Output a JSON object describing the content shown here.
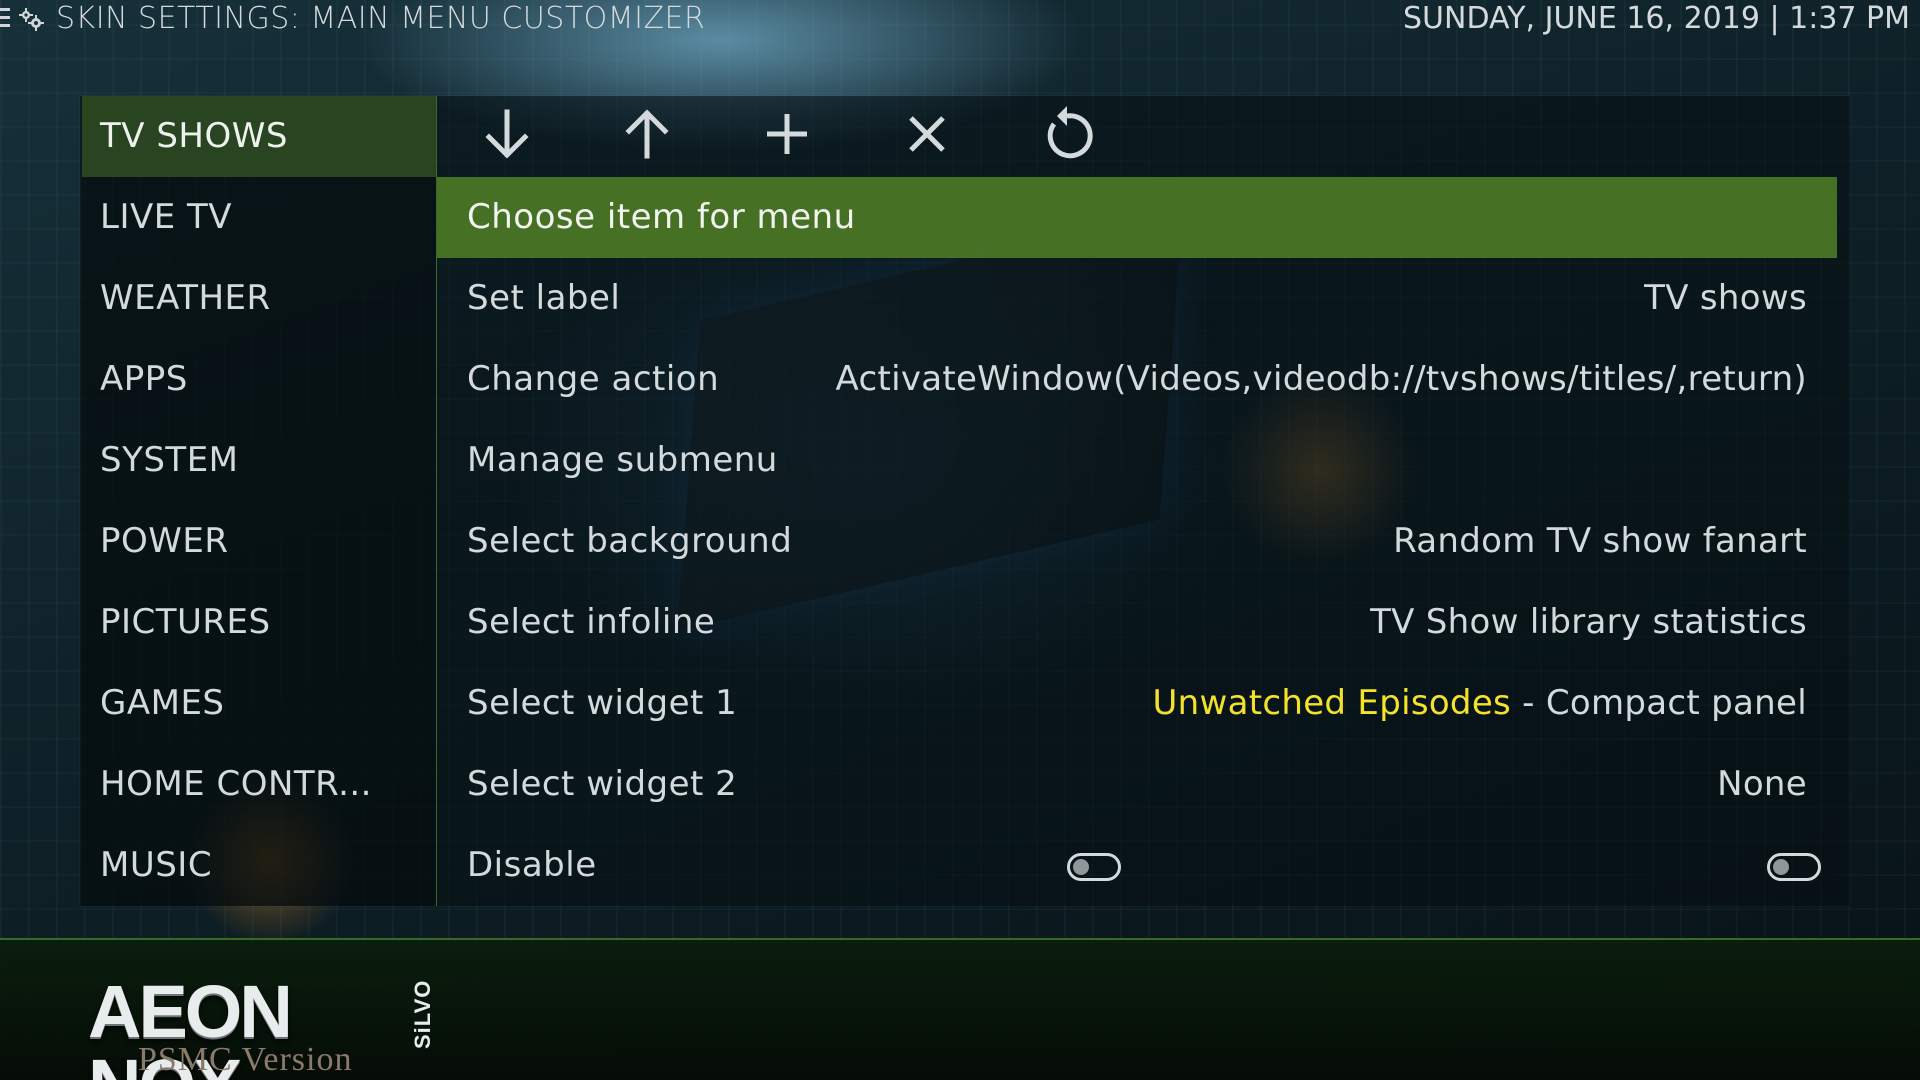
{
  "header": {
    "title": "SKIN SETTINGS: MAIN MENU CUSTOMIZER",
    "datetime": "SUNDAY, JUNE 16, 2019 | 1:37 PM"
  },
  "sidebar": {
    "items": [
      {
        "label": "TV SHOWS",
        "active": true
      },
      {
        "label": "LIVE TV"
      },
      {
        "label": "WEATHER"
      },
      {
        "label": "APPS"
      },
      {
        "label": "SYSTEM"
      },
      {
        "label": "POWER"
      },
      {
        "label": "PICTURES"
      },
      {
        "label": "GAMES"
      },
      {
        "label": "HOME CONTR..."
      },
      {
        "label": "MUSIC"
      }
    ]
  },
  "toolbar": {
    "icons": [
      "move-down-icon",
      "move-up-icon",
      "add-icon",
      "delete-icon",
      "reset-icon"
    ]
  },
  "options": {
    "items": [
      {
        "label": "Choose item for menu",
        "value": "",
        "active": true
      },
      {
        "label": "Set label",
        "value": "TV shows"
      },
      {
        "label": "Change action",
        "value": "ActivateWindow(Videos,videodb://tvshows/titles/,return)"
      },
      {
        "label": "Manage submenu",
        "value": ""
      },
      {
        "label": "Select background",
        "value": "Random TV show fanart"
      },
      {
        "label": "Select infoline",
        "value": "TV Show library statistics"
      },
      {
        "label": "Select widget 1",
        "value_accent": "Unwatched Episodes",
        "value": " - Compact panel"
      },
      {
        "label": "Select widget 2",
        "value": "None"
      },
      {
        "label": "Disable",
        "toggle_left": false,
        "toggle_right": false
      }
    ]
  },
  "colors": {
    "accent_green": "#4e7d26",
    "highlight_yellow": "#f4e22a"
  },
  "logo": {
    "main": "AEON NOX",
    "side": "SiLVO",
    "sub": "PSMC Version"
  }
}
